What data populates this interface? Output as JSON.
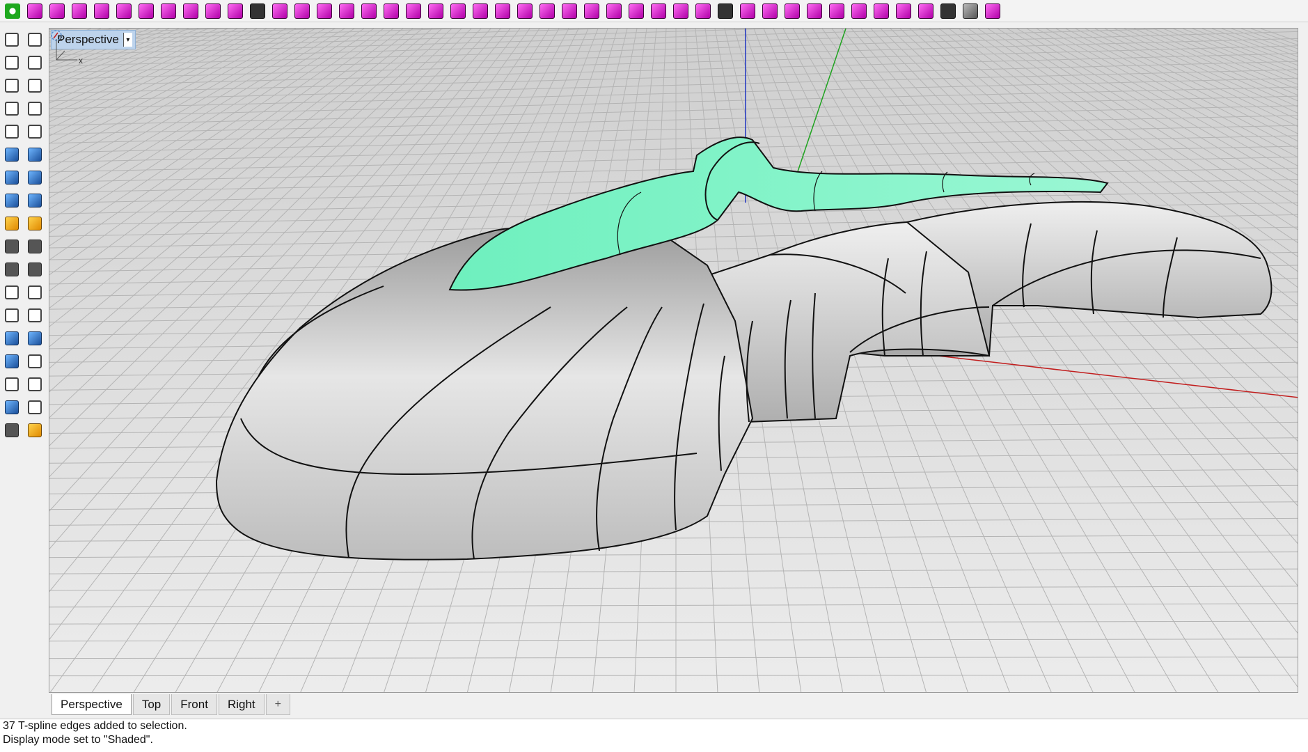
{
  "toolbar": {
    "icons": [
      {
        "name": "power-icon",
        "style": "green"
      },
      {
        "name": "box-icon",
        "style": "magenta"
      },
      {
        "name": "box-faces-icon",
        "style": "magenta"
      },
      {
        "name": "curve-edit-icon",
        "style": "magenta"
      },
      {
        "name": "grid-insert-icon",
        "style": "magenta"
      },
      {
        "name": "cube-wire-icon",
        "style": "magenta"
      },
      {
        "name": "arrow-curve-icon",
        "style": "magenta"
      },
      {
        "name": "pull-icon",
        "style": "magenta"
      },
      {
        "name": "split-icon",
        "style": "magenta"
      },
      {
        "name": "surface-patch-icon",
        "style": "magenta"
      },
      {
        "name": "crease-icon",
        "style": "magenta"
      },
      {
        "name": "arch-icon",
        "style": "dark"
      },
      {
        "name": "extrude-icon",
        "style": "magenta"
      },
      {
        "name": "bridge-icon",
        "style": "magenta"
      },
      {
        "name": "cube-insert-icon",
        "style": "magenta"
      },
      {
        "name": "grid-edit-icon",
        "style": "magenta"
      },
      {
        "name": "down-arrow-icon",
        "style": "magenta"
      },
      {
        "name": "diamond-icon",
        "style": "magenta"
      },
      {
        "name": "fold-icon",
        "style": "magenta"
      },
      {
        "name": "mesh-grid-icon",
        "style": "magenta"
      },
      {
        "name": "check-grid-icon",
        "style": "magenta"
      },
      {
        "name": "checker-icon",
        "style": "magenta"
      },
      {
        "name": "weld-icon",
        "style": "magenta"
      },
      {
        "name": "delete-grid-icon",
        "style": "magenta"
      },
      {
        "name": "symmetry-icon",
        "style": "magenta"
      },
      {
        "name": "mirror-icon",
        "style": "magenta"
      },
      {
        "name": "loop-icon",
        "style": "magenta"
      },
      {
        "name": "swirl-icon",
        "style": "magenta"
      },
      {
        "name": "cylinder-icon",
        "style": "magenta"
      },
      {
        "name": "dots-grid-icon",
        "style": "magenta"
      },
      {
        "name": "curve-snap-icon",
        "style": "magenta"
      },
      {
        "name": "hand-icon",
        "style": "magenta"
      },
      {
        "name": "branch-icon",
        "style": "dark"
      },
      {
        "name": "node-icon",
        "style": "magenta"
      },
      {
        "name": "eraser-icon",
        "style": "magenta"
      },
      {
        "name": "target-icon",
        "style": "magenta"
      },
      {
        "name": "star-icon",
        "style": "magenta"
      },
      {
        "name": "polyhedron-icon",
        "style": "magenta"
      },
      {
        "name": "bars-icon",
        "style": "magenta"
      },
      {
        "name": "sheet-icon",
        "style": "magenta"
      },
      {
        "name": "plane-icon",
        "style": "magenta"
      },
      {
        "name": "grid-plane-icon",
        "style": "magenta"
      },
      {
        "name": "scissors-icon",
        "style": "dark"
      },
      {
        "name": "cube-solid-icon",
        "style": "grey"
      },
      {
        "name": "gear-icon",
        "style": "magenta"
      }
    ]
  },
  "left_toolbar": {
    "icons": [
      {
        "name": "select-arrow-icon",
        "style": "plain"
      },
      {
        "name": "point-icon",
        "style": "plain"
      },
      {
        "name": "polyline-icon",
        "style": "plain"
      },
      {
        "name": "curve-icon",
        "style": "plain"
      },
      {
        "name": "circle-icon",
        "style": "plain"
      },
      {
        "name": "ellipse-icon",
        "style": "plain"
      },
      {
        "name": "arc-icon",
        "style": "plain"
      },
      {
        "name": "rectangle-icon",
        "style": "plain"
      },
      {
        "name": "polygon-icon",
        "style": "plain"
      },
      {
        "name": "fillet-curve-icon",
        "style": "plain"
      },
      {
        "name": "surface-icon",
        "style": "blue"
      },
      {
        "name": "revolve-icon",
        "style": "blue"
      },
      {
        "name": "solid-box-icon",
        "style": "blue"
      },
      {
        "name": "boolean-icon",
        "style": "blue"
      },
      {
        "name": "cylinder-icon",
        "style": "blue"
      },
      {
        "name": "plane-surface-icon",
        "style": "blue"
      },
      {
        "name": "explode-icon",
        "style": "orange"
      },
      {
        "name": "lightning-icon",
        "style": "orange"
      },
      {
        "name": "trim-icon",
        "style": "dark"
      },
      {
        "name": "split-icon",
        "style": "dark"
      },
      {
        "name": "group-icon",
        "style": "dark"
      },
      {
        "name": "ungroup-icon",
        "style": "dark"
      },
      {
        "name": "fillet-edge-icon",
        "style": "plain"
      },
      {
        "name": "offset-icon",
        "style": "plain"
      },
      {
        "name": "text-icon",
        "style": "plain"
      },
      {
        "name": "scale-icon",
        "style": "plain"
      },
      {
        "name": "array-icon",
        "style": "blue"
      },
      {
        "name": "move-icon",
        "style": "blue"
      },
      {
        "name": "solid-edit-icon",
        "style": "blue"
      },
      {
        "name": "dimension-icon",
        "style": "plain"
      },
      {
        "name": "grid-array-icon",
        "style": "plain"
      },
      {
        "name": "gumball-icon",
        "style": "plain"
      },
      {
        "name": "analyze-icon",
        "style": "blue"
      },
      {
        "name": "checkmark-icon",
        "style": "plain"
      },
      {
        "name": "render-icon",
        "style": "dark"
      },
      {
        "name": "light-icon",
        "style": "orange"
      }
    ]
  },
  "viewport": {
    "title": "Perspective",
    "caret": "▾",
    "axis": {
      "z": "z",
      "x": "x"
    }
  },
  "tabs": [
    {
      "label": "Perspective",
      "active": true
    },
    {
      "label": "Top",
      "active": false
    },
    {
      "label": "Front",
      "active": false
    },
    {
      "label": "Right",
      "active": false
    },
    {
      "label": "+",
      "active": false
    }
  ],
  "command_history": [
    "37 T-spline edges added to selection.",
    "Display mode set to \"Shaded\"."
  ],
  "colors": {
    "selected_surface": "#7ff2c6",
    "grid_line": "#b8b8b8",
    "x_axis": "#c21e1e",
    "y_axis": "#1fa31f",
    "z_axis": "#1f34c2"
  }
}
